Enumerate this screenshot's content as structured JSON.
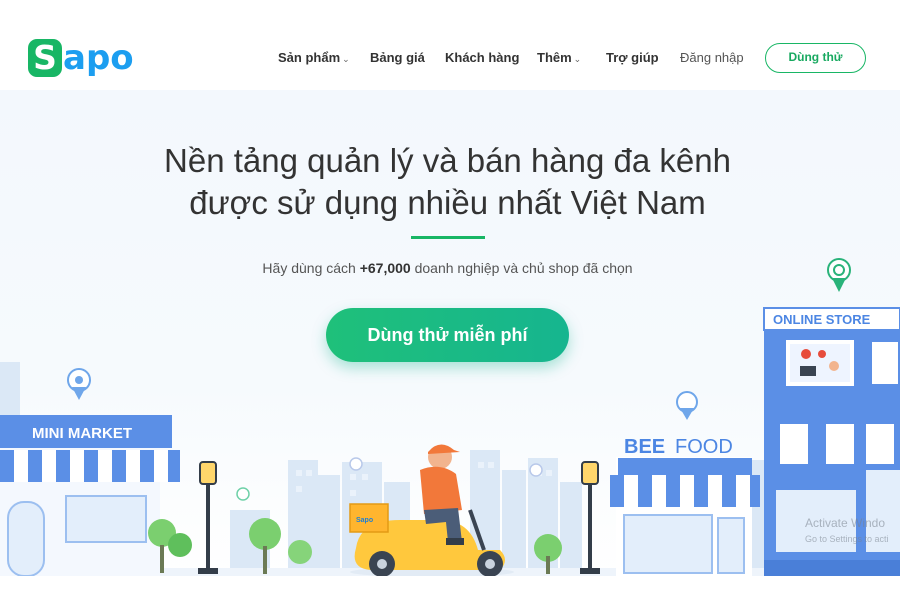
{
  "brand": {
    "logo_s": "S",
    "logo_rest": "apo",
    "primary": "#18b665",
    "secondary": "#1c9ef0"
  },
  "nav": {
    "items": [
      {
        "label": "Sản phẩm",
        "dropdown": true
      },
      {
        "label": "Bảng giá",
        "dropdown": false
      },
      {
        "label": "Khách hàng",
        "dropdown": false
      },
      {
        "label": "Thêm",
        "dropdown": true
      },
      {
        "label": "Trợ giúp",
        "dropdown": false
      }
    ],
    "login": "Đăng nhập",
    "trial": "Dùng thử"
  },
  "hero": {
    "title_line1": "Nền tảng quản lý và bán hàng đa kênh",
    "title_line2": "được sử dụng nhiều nhất Việt Nam",
    "sub_prefix": "Hãy dùng cách ",
    "sub_count": "+67,000",
    "sub_suffix": " doanh nghiệp và chủ shop đã chọn",
    "cta": "Dùng thử miễn phí"
  },
  "illustration": {
    "mini_market": "MINI MARKET",
    "bee_food_1": "BEE",
    "bee_food_2": "FOOD",
    "online_store": "ONLINE STORE",
    "box_brand": "Sapo"
  },
  "watermark": {
    "line1": "Activate Windo",
    "line2": "Go to Settings to acti"
  }
}
